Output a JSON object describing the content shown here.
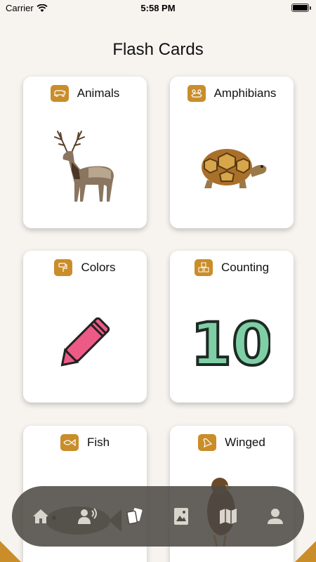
{
  "status_bar": {
    "carrier": "Carrier",
    "time": "5:58 PM",
    "battery_level": 1.0
  },
  "page": {
    "title": "Flash Cards"
  },
  "cards": [
    {
      "label": "Animals",
      "icon": "bear-icon",
      "image": "elk-image"
    },
    {
      "label": "Amphibians",
      "icon": "frog-icon",
      "image": "turtle-image"
    },
    {
      "label": "Colors",
      "icon": "paint-roller-icon",
      "image": "crayon-image"
    },
    {
      "label": "Counting",
      "icon": "number-blocks-icon",
      "image": "number-ten-image",
      "image_text": "10"
    },
    {
      "label": "Fish",
      "icon": "fish-icon",
      "image": "fish-image"
    },
    {
      "label": "Winged",
      "icon": "bird-icon",
      "image": "hawk-image"
    }
  ],
  "tab_bar": {
    "tabs": [
      {
        "name": "home",
        "icon": "home-icon",
        "active": false
      },
      {
        "name": "sounds",
        "icon": "speaking-person-icon",
        "active": false
      },
      {
        "name": "flash-cards",
        "icon": "cards-icon",
        "active": true
      },
      {
        "name": "gallery",
        "icon": "photo-book-icon",
        "active": false
      },
      {
        "name": "map",
        "icon": "map-icon",
        "active": false
      },
      {
        "name": "profile",
        "icon": "person-icon",
        "active": false
      }
    ]
  },
  "colors": {
    "background": "#f7f4f0",
    "badge": "#c98d2a",
    "tab_bar": "#4e4a44",
    "tab_icon": "#d9d4cc",
    "tab_icon_active": "#ffffff"
  }
}
